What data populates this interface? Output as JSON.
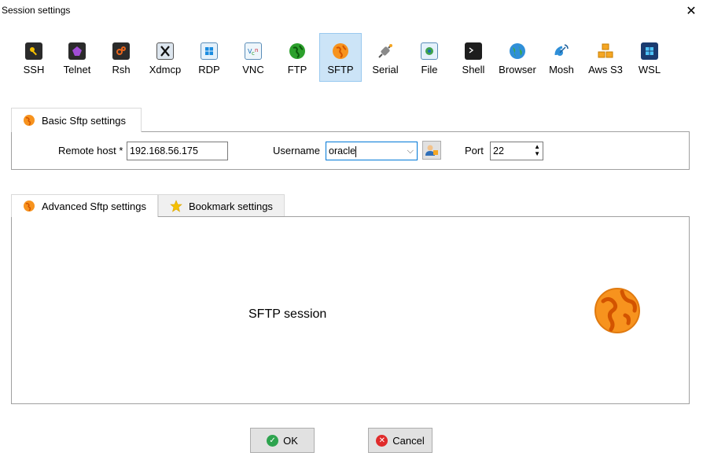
{
  "window": {
    "title": "Session settings",
    "close_glyph": "✕"
  },
  "session_types": [
    {
      "label": "SSH",
      "icon": "ssh-icon",
      "selected": false
    },
    {
      "label": "Telnet",
      "icon": "telnet-icon",
      "selected": false
    },
    {
      "label": "Rsh",
      "icon": "rsh-icon",
      "selected": false
    },
    {
      "label": "Xdmcp",
      "icon": "xdmcp-icon",
      "selected": false
    },
    {
      "label": "RDP",
      "icon": "rdp-icon",
      "selected": false
    },
    {
      "label": "VNC",
      "icon": "vnc-icon",
      "selected": false
    },
    {
      "label": "FTP",
      "icon": "ftp-icon",
      "selected": false
    },
    {
      "label": "SFTP",
      "icon": "sftp-icon",
      "selected": true
    },
    {
      "label": "Serial",
      "icon": "serial-icon",
      "selected": false
    },
    {
      "label": "File",
      "icon": "file-icon",
      "selected": false
    },
    {
      "label": "Shell",
      "icon": "shell-icon",
      "selected": false
    },
    {
      "label": "Browser",
      "icon": "browser-icon",
      "selected": false
    },
    {
      "label": "Mosh",
      "icon": "mosh-icon",
      "selected": false
    },
    {
      "label": "Aws S3",
      "icon": "aws-s3-icon",
      "selected": false
    },
    {
      "label": "WSL",
      "icon": "wsl-icon",
      "selected": false
    }
  ],
  "basic": {
    "tab_label": "Basic Sftp settings",
    "remote_host_label": "Remote host *",
    "remote_host_value": "192.168.56.175",
    "username_label": "Username",
    "username_value": "oracle",
    "port_label": "Port",
    "port_value": "22"
  },
  "advanced": {
    "tabs": [
      {
        "label": "Advanced Sftp settings",
        "icon": "sftp-icon"
      },
      {
        "label": "Bookmark settings",
        "icon": "star-icon"
      }
    ],
    "session_text": "SFTP session"
  },
  "buttons": {
    "ok_label": "OK",
    "cancel_label": "Cancel"
  },
  "colors": {
    "selected_bg": "#cce4f7",
    "selected_border": "#99c9ef",
    "sftp_orange": "#f7931e",
    "ok_green": "#2ea44f",
    "cancel_red": "#e02b2b"
  }
}
